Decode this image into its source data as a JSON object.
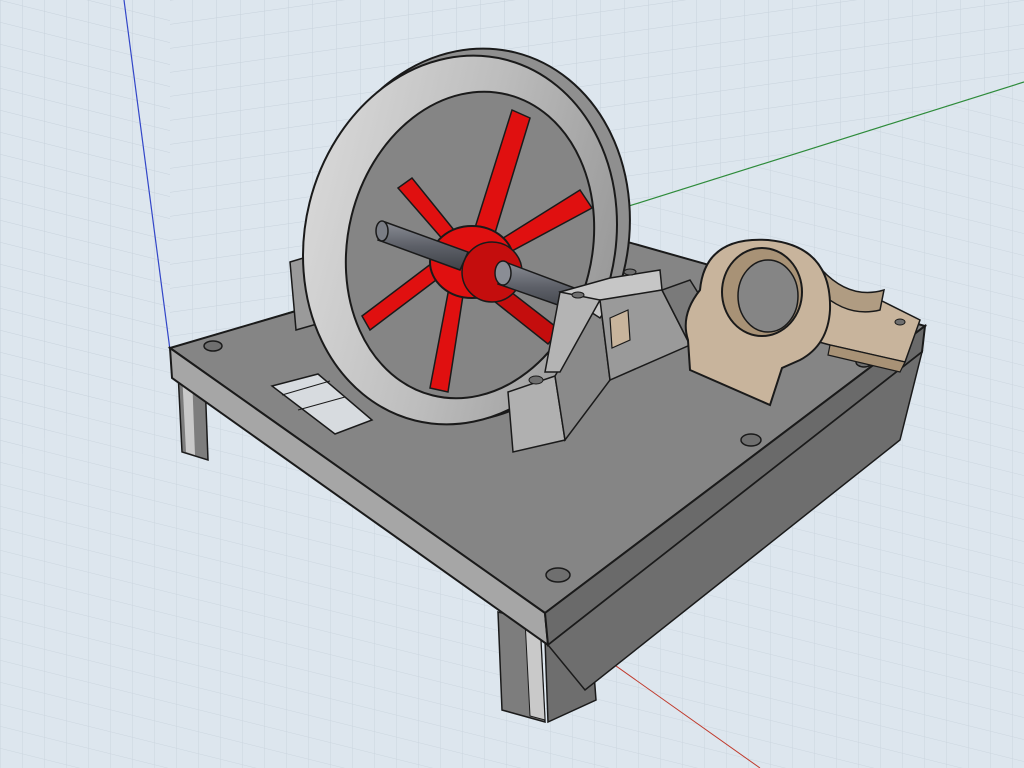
{
  "viewport": {
    "colors": {
      "background": "#dde6ee",
      "grid_minor": "#c8d2dc",
      "grid_major": "#b4c0cc",
      "axis_x": "#c0392b",
      "axis_y": "#2e8b3a",
      "axis_z": "#3346c8",
      "base_top": "#858585",
      "base_front": "#7a7a7a",
      "base_side": "#6a6a6a",
      "base_edge": "#b8b8b8",
      "leg": "#7d7d7d",
      "leg_light": "#c9c9c9",
      "flywheel_rim": "#bdbdbd",
      "flywheel_rim_dark": "#8f8f8f",
      "spokes": "#e01010",
      "spokes_dark": "#9c0a0a",
      "shaft": "#5d6068",
      "bearing_block": "#b0b0b0",
      "bearing_block_dark": "#8a8a8a",
      "cylinder_mount": "#c8b49c",
      "cylinder_mount_dark": "#a89276",
      "outline": "#1a1a1a",
      "hole": "#6f6f6f"
    },
    "parts": [
      {
        "id": "base-plate",
        "icon": "base-plate-icon"
      },
      {
        "id": "legs",
        "icon": "leg-icon"
      },
      {
        "id": "flywheel",
        "icon": "flywheel-icon"
      },
      {
        "id": "crankshaft",
        "icon": "shaft-icon"
      },
      {
        "id": "main-bearing",
        "icon": "bearing-icon"
      },
      {
        "id": "cylinder-mount",
        "icon": "cylinder-mount-icon"
      }
    ]
  }
}
